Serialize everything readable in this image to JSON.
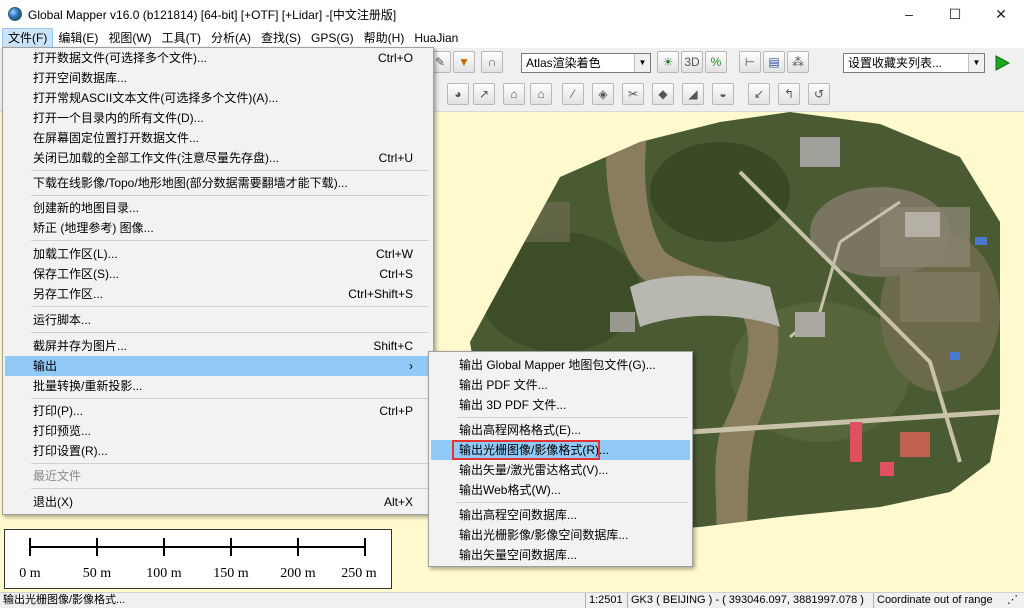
{
  "window": {
    "title": "Global Mapper v16.0 (b121814) [64-bit] [+OTF] [+Lidar] -[中文注册版]",
    "controls": [
      "–",
      "☐",
      "✕"
    ]
  },
  "menubar": {
    "items": [
      "文件(F)",
      "编辑(E)",
      "视图(W)",
      "工具(T)",
      "分析(A)",
      "查找(S)",
      "GPS(G)",
      "帮助(H)",
      "HuaJian"
    ]
  },
  "toolbar": {
    "shader_select": "Atlas渲染着色",
    "bookmark_select": "设置收藏夹列表...",
    "icons_row1": [
      "pen-icon",
      "triangle-down-icon",
      "arch-icon",
      "shader-a-icon",
      "shader-b-icon",
      "shader-c-icon",
      "measure-icon",
      "layers-icon",
      "grid-icon"
    ],
    "icons_row2": [
      "digitize-1-icon",
      "digitize-2-icon",
      "digitize-3-icon",
      "digitize-4-icon",
      "digitize-5-icon",
      "digitize-6-icon",
      "digitize-7-icon",
      "digitize-8-icon",
      "digitize-9-icon",
      "digitize-10-icon",
      "digitize-11-icon",
      "digitize-12-icon",
      "digitize-13-icon",
      "digitize-14-icon",
      "digitize-15-icon",
      "digitize-16-icon"
    ]
  },
  "file_menu": {
    "items": [
      {
        "label": "打开数据文件(可选择多个文件)...",
        "shortcut": "Ctrl+O"
      },
      {
        "label": "打开空间数据库...",
        "shortcut": ""
      },
      {
        "label": "打开常规ASCII文本文件(可选择多个文件)(A)...",
        "shortcut": ""
      },
      {
        "label": "打开一个目录内的所有文件(D)...",
        "shortcut": ""
      },
      {
        "label": "在屏幕固定位置打开数据文件...",
        "shortcut": ""
      },
      {
        "label": "关闭已加载的全部工作文件(注意尽量先存盘)...",
        "shortcut": "Ctrl+U"
      },
      {
        "label": "下载在线影像/Topo/地形地图(部分数据需要翻墙才能下载)...",
        "shortcut": ""
      },
      {
        "label": "创建新的地图目录...",
        "shortcut": ""
      },
      {
        "label": "矫正 (地理参考) 图像...",
        "shortcut": ""
      },
      {
        "label": "加载工作区(L)...",
        "shortcut": "Ctrl+W"
      },
      {
        "label": "保存工作区(S)...",
        "shortcut": "Ctrl+S"
      },
      {
        "label": "另存工作区...",
        "shortcut": "Ctrl+Shift+S"
      },
      {
        "label": "运行脚本...",
        "shortcut": ""
      },
      {
        "label": "截屏并存为图片...",
        "shortcut": "Shift+C"
      },
      {
        "label": "输出",
        "shortcut": "›"
      },
      {
        "label": "批量转换/重新投影...",
        "shortcut": ""
      },
      {
        "label": "打印(P)...",
        "shortcut": "Ctrl+P"
      },
      {
        "label": "打印预览...",
        "shortcut": ""
      },
      {
        "label": "打印设置(R)...",
        "shortcut": ""
      },
      {
        "label": "最近文件",
        "shortcut": ""
      },
      {
        "label": "退出(X)",
        "shortcut": "Alt+X"
      }
    ]
  },
  "export_submenu": {
    "items": [
      "输出 Global Mapper 地图包文件(G)...",
      "输出 PDF 文件...",
      "输出 3D PDF 文件...",
      "输出高程网格格式(E)...",
      "输出光栅图像/影像格式(R)...",
      "输出矢量/激光雷达格式(V)...",
      "输出Web格式(W)...",
      "输出高程空间数据库...",
      "输出光栅影像/影像空间数据库...",
      "输出矢量空间数据库..."
    ]
  },
  "scalebar": {
    "labels": [
      "0 m",
      "50 m",
      "100 m",
      "150 m",
      "200 m",
      "250 m"
    ]
  },
  "statusbar": {
    "message": "输出光栅图像/影像格式...",
    "scale": "1:2501",
    "projection": "GK3 ( BEIJING ) - ( 393046.097, 3881997.078 )",
    "coord_status": "Coordinate out of range"
  },
  "colors": {
    "canvas_bg": "#fffacd",
    "menu_highlight": "#91c9f7",
    "highlight_box": "#e53232",
    "go_button": "#1fa81f"
  }
}
